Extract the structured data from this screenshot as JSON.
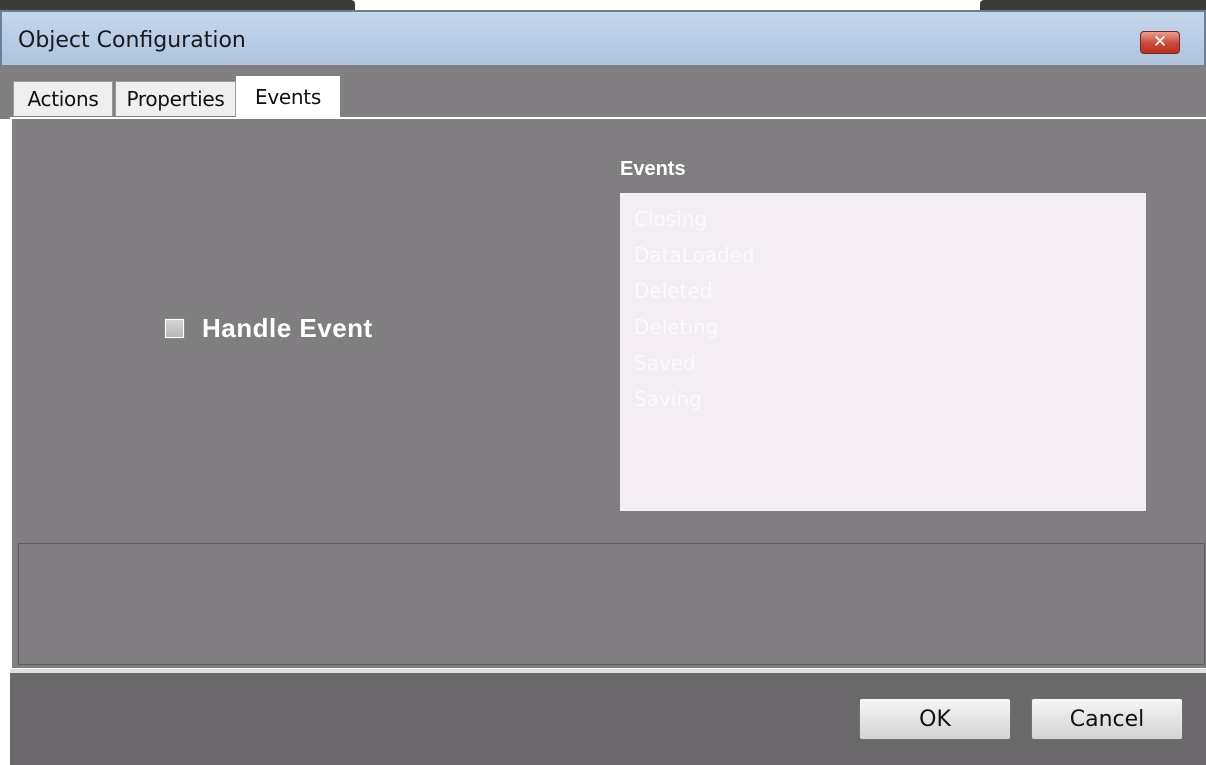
{
  "window": {
    "title": "Object Configuration",
    "close_glyph": "✕"
  },
  "tabs": [
    {
      "label": "Actions",
      "selected": false
    },
    {
      "label": "Properties",
      "selected": false
    },
    {
      "label": "Events",
      "selected": true
    }
  ],
  "events_panel": {
    "handle_event_label": "Handle Event",
    "handle_event_checked": false,
    "list_heading": "Events",
    "items": [
      "Closing",
      "DataLoaded",
      "Deleted",
      "Deleting",
      "Saved",
      "Saving"
    ]
  },
  "footer": {
    "ok_label": "OK",
    "cancel_label": "Cancel"
  },
  "colors": {
    "panel_bg": "#807e80",
    "titlebar": "#b7cbe4",
    "list_bg": "#f4eef4",
    "close_button": "#c9483a"
  }
}
